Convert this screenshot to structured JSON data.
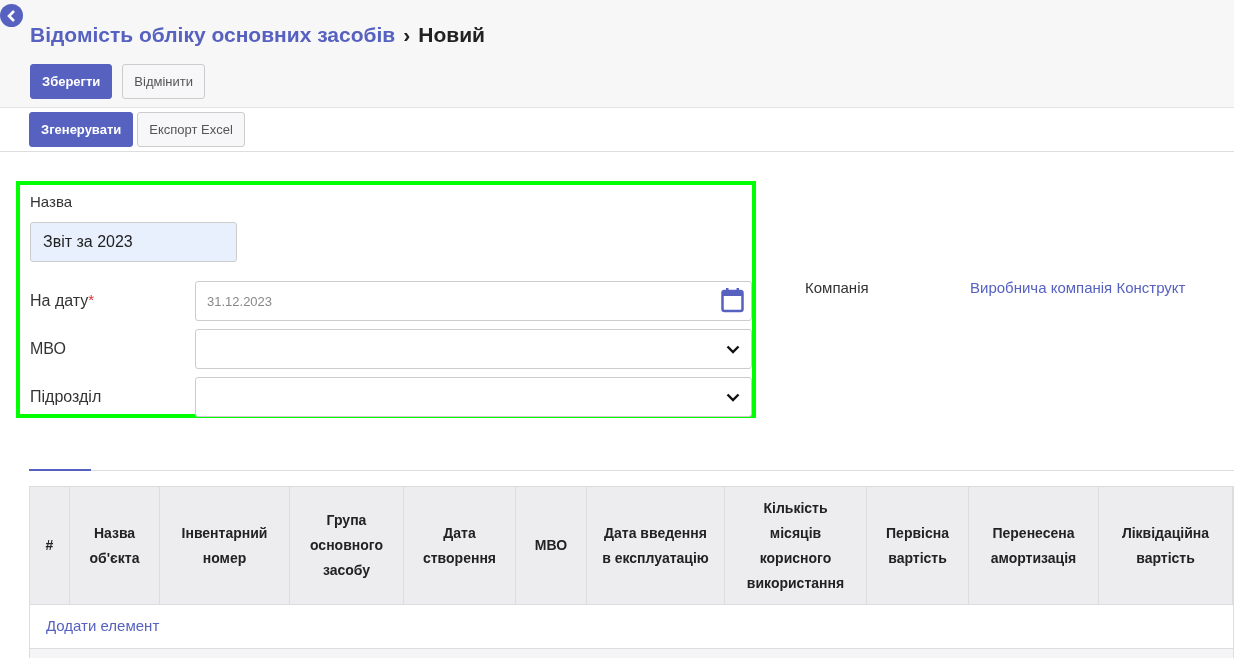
{
  "breadcrumb": {
    "parent": "Відомість обліку основних засобів",
    "separator": "›",
    "current": "Новий"
  },
  "actions": [
    {
      "label": "Зберегти",
      "kind": "primary"
    },
    {
      "label": "Відмінити",
      "kind": "secondary"
    }
  ],
  "toolbar": [
    {
      "label": "Згенерувати",
      "kind": "primary"
    },
    {
      "label": "Експорт Excel",
      "kind": "secondary"
    }
  ],
  "form": {
    "name": {
      "label": "Назва",
      "value": "Звіт за 2023"
    },
    "fields": [
      {
        "label": "На дату",
        "required_mark": "*",
        "kind": "date",
        "placeholder": "31.12.2023"
      },
      {
        "label": "МВО",
        "kind": "select"
      },
      {
        "label": "Підрозділ",
        "kind": "select"
      }
    ]
  },
  "company": {
    "label": "Компанія",
    "value": "Виробнича компанія Конструкт"
  },
  "table": {
    "columns": [
      "#",
      "Назва об'єкта",
      "Інвентарний номер",
      "Група основного засобу",
      "Дата створення",
      "МВО",
      "Дата введення в експлуатацію",
      "Кількість місяців корисного використання",
      "Первісна вартість",
      "Перенесена амортизація",
      "Ліквідаційна вартість"
    ],
    "add_link": "Додати елемент"
  }
}
